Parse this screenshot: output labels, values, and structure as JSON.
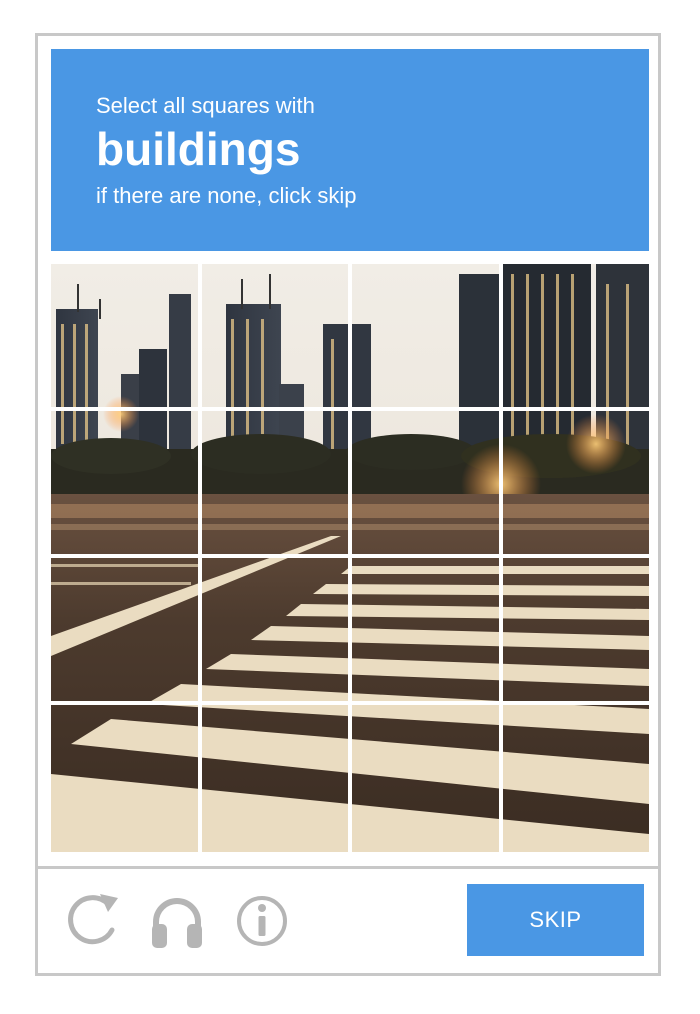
{
  "challenge": {
    "instruction": "Select all squares with",
    "target": "buildings",
    "hint": "if there are none, click skip"
  },
  "grid": {
    "rows": 4,
    "cols": 4
  },
  "footer": {
    "icons": [
      "reload-icon",
      "headphones-icon",
      "info-icon"
    ],
    "skip_label": "SKIP"
  },
  "colors": {
    "accent": "#4a97e4",
    "border": "#c8c8c8",
    "icon": "#b5b5b5"
  }
}
